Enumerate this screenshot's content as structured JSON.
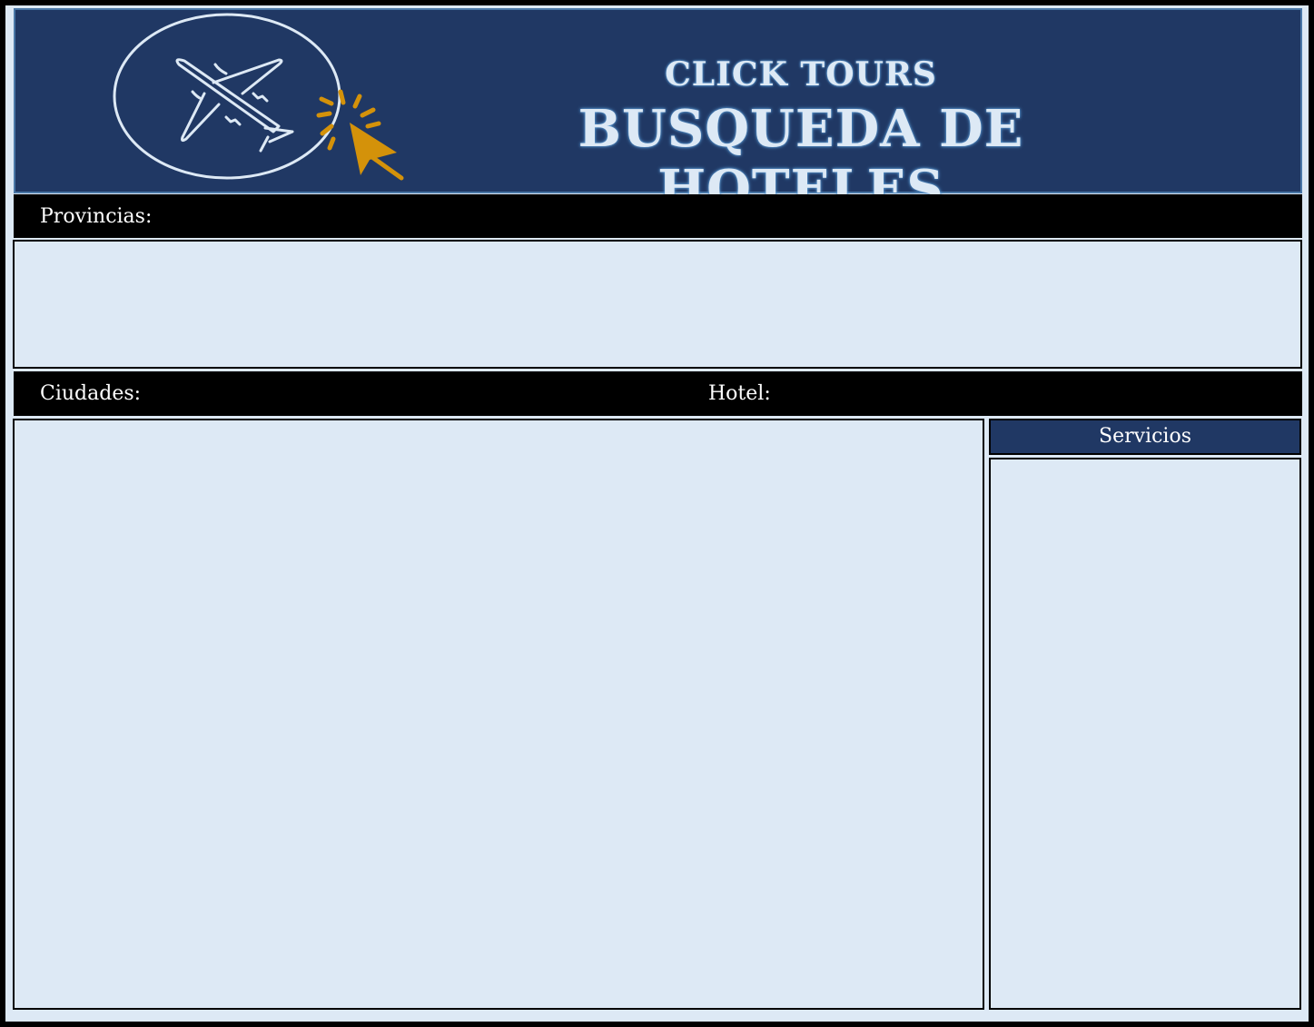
{
  "header": {
    "brand": "CLICK TOURS",
    "title": "BUSQUEDA DE HOTELES",
    "logo_icon": "airplane-click-icon"
  },
  "labels": {
    "provincias": "Provincias:",
    "ciudades": "Ciudades:",
    "hotel": "Hotel:",
    "servicios": "Servicios"
  },
  "colors": {
    "header_bg": "#203864",
    "panel_bg": "#dde9f5",
    "accent": "#d4920a"
  }
}
